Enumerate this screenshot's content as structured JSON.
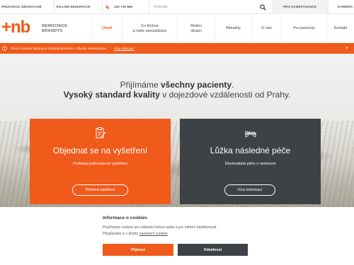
{
  "topbar": {
    "doctor_link": "PRŮVODCE OBOROVÁNÍ",
    "online_booking": "ON-LINE REZERVACE",
    "phone": "326 749 666",
    "search_placeholder": "Vyhledat",
    "staff_link": "PRO ZAMĚSTNANCE",
    "career_link": "KARIÉRA"
  },
  "logo": {
    "mark": "+nb",
    "line1": "NEMOCNICE",
    "line2": "BRANDÝS"
  },
  "nav": {
    "items": [
      {
        "label": "Úvod",
        "active": true
      },
      {
        "label1": "Co léčíme",
        "label2": "a naše specializace"
      },
      {
        "label1": "Řešim",
        "label2": "situaci"
      },
      {
        "label": "Aktuality"
      },
      {
        "label": "O nás"
      },
      {
        "label": "Pro pacienty"
      },
      {
        "label": "Kontakt"
      }
    ]
  },
  "alert": {
    "text": "Provoz Ústavní lékárny je dočasně přerušen z důvodu rekonstrukce.",
    "link": "Více informací",
    "close": "×"
  },
  "hero": {
    "line1_pre": "Přijímáme ",
    "line1_bold": "všechny pacienty",
    "line1_post": ".",
    "line2_bold": "Vysoký standard kvality",
    "line2_post": " v dojezdové vzdálenosti od Prahy."
  },
  "cards": [
    {
      "title": "Objednat se na vyšetření",
      "subtitle": "Potřebuji jednorázové vyšetření",
      "button": "Přehled oddělení",
      "icon": "clipboard-edit-icon"
    },
    {
      "title": "Lůžka následné péče",
      "subtitle": "Dlouhodobá péče o nemocné",
      "button": "Více informací",
      "icon": "hospital-bed-icon"
    }
  ],
  "cookie": {
    "title": "Informace o cookies",
    "text1": "Používáme cookies pro základní funkce webu a pro měření návštěvnosti.",
    "text2_pre": "Přizpůsobte si v těchto ",
    "text2_link": "nastavení cookies",
    "accept": "Přijmout",
    "reject": "Odmítnout"
  },
  "colors": {
    "brand": "#f05a1a",
    "dark": "#3d4247"
  }
}
